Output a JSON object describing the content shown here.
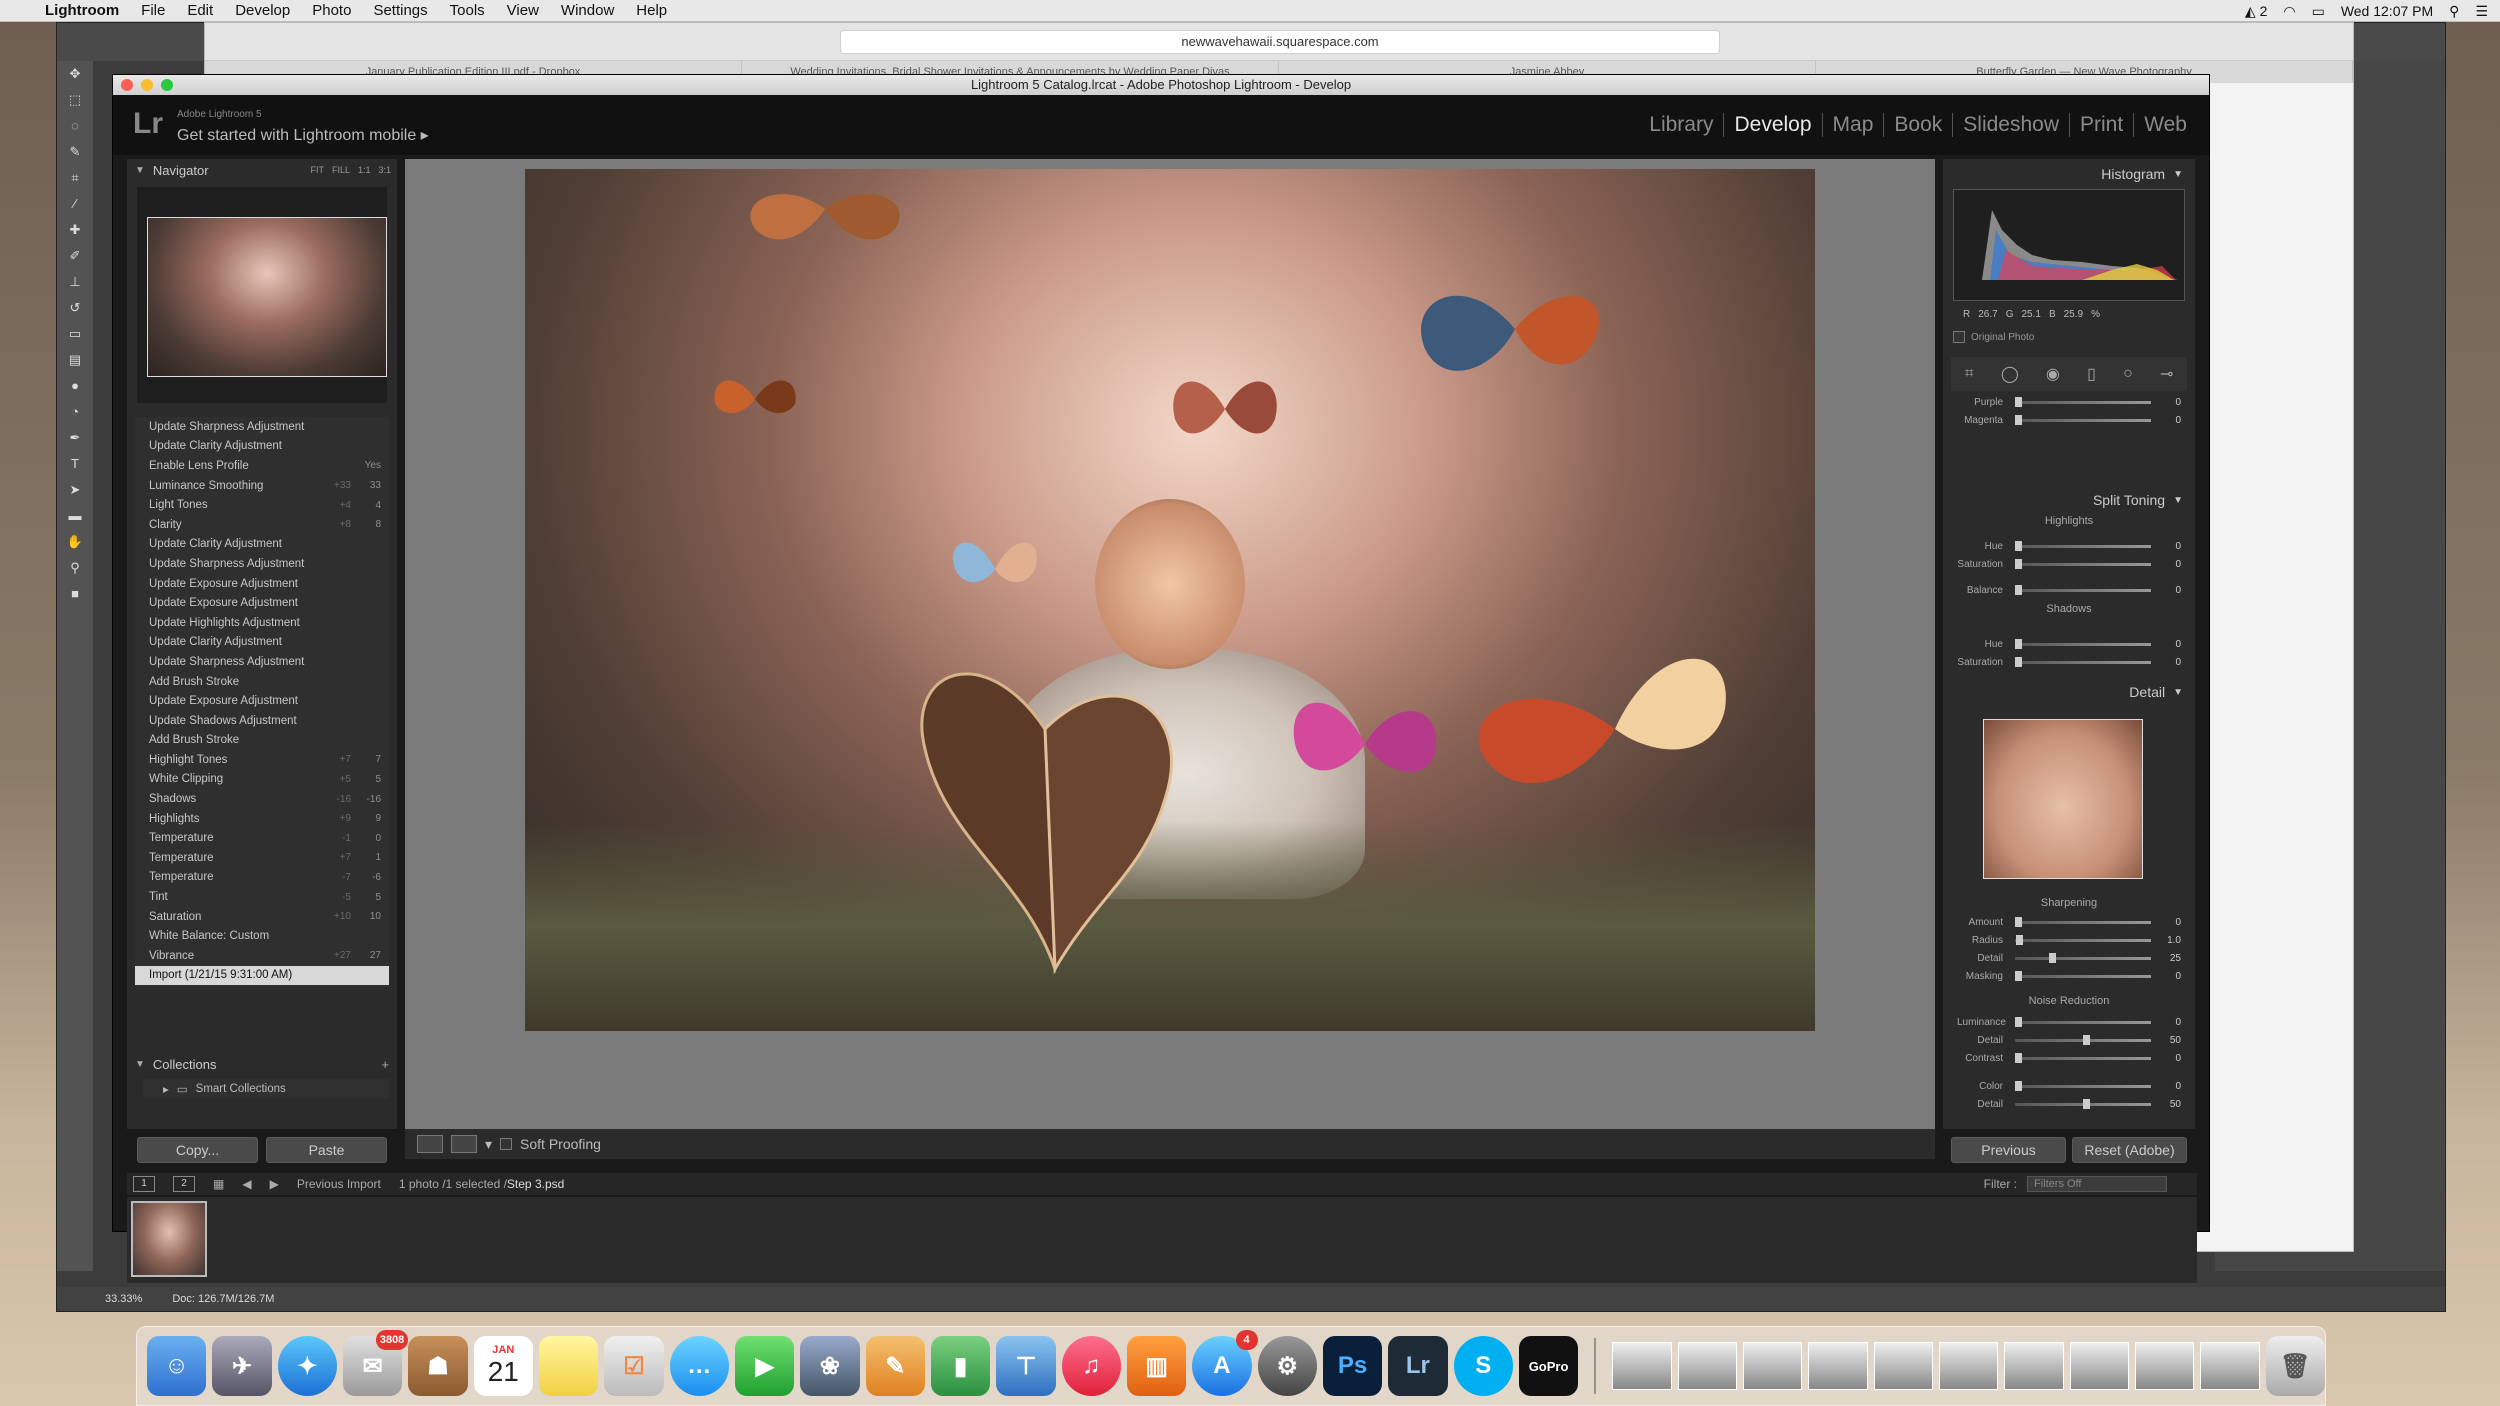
{
  "menubar": {
    "app": "Lightroom",
    "items": [
      "File",
      "Edit",
      "Develop",
      "Photo",
      "Settings",
      "Tools",
      "View",
      "Window",
      "Help"
    ],
    "status_count": "2",
    "clock": "Wed 12:07 PM"
  },
  "browser": {
    "url": "newwavehawaii.squarespace.com",
    "tabs": [
      "January Publication Edition III.pdf - Dropbox",
      "Wedding Invitations, Bridal Shower Invitations & Announcements by Wedding Paper Divas",
      "Jasmine Abbey",
      "Butterfly Garden — New Wave Photography"
    ]
  },
  "photoshop": {
    "zoom": "33.33%",
    "doc": "Doc: 126.7M/126.7M"
  },
  "lightroom": {
    "window_title": "Lightroom 5 Catalog.lrcat - Adobe Photoshop Lightroom - Develop",
    "product": "Adobe Lightroom 5",
    "mobile": "Get started with Lightroom mobile",
    "modules": [
      "Library",
      "Develop",
      "Map",
      "Book",
      "Slideshow",
      "Print",
      "Web"
    ],
    "navigator": {
      "title": "Navigator",
      "options": [
        "FIT",
        "FILL",
        "1:1",
        "3:1"
      ]
    },
    "history": [
      {
        "name": "Update Sharpness Adjustment",
        "delta": "",
        "val": ""
      },
      {
        "name": "Update Clarity Adjustment",
        "delta": "",
        "val": ""
      },
      {
        "name": "Enable Lens Profile",
        "delta": "",
        "val": "Yes"
      },
      {
        "name": "Luminance Smoothing",
        "delta": "+33",
        "val": "33"
      },
      {
        "name": "Light Tones",
        "delta": "+4",
        "val": "4"
      },
      {
        "name": "Clarity",
        "delta": "+8",
        "val": "8"
      },
      {
        "name": "Update Clarity Adjustment",
        "delta": "",
        "val": ""
      },
      {
        "name": "Update Sharpness Adjustment",
        "delta": "",
        "val": ""
      },
      {
        "name": "Update Exposure Adjustment",
        "delta": "",
        "val": ""
      },
      {
        "name": "Update Exposure Adjustment",
        "delta": "",
        "val": ""
      },
      {
        "name": "Update Highlights Adjustment",
        "delta": "",
        "val": ""
      },
      {
        "name": "Update Clarity Adjustment",
        "delta": "",
        "val": ""
      },
      {
        "name": "Update Sharpness Adjustment",
        "delta": "",
        "val": ""
      },
      {
        "name": "Add Brush Stroke",
        "delta": "",
        "val": ""
      },
      {
        "name": "Update Exposure Adjustment",
        "delta": "",
        "val": ""
      },
      {
        "name": "Update Shadows Adjustment",
        "delta": "",
        "val": ""
      },
      {
        "name": "Add Brush Stroke",
        "delta": "",
        "val": ""
      },
      {
        "name": "Highlight Tones",
        "delta": "+7",
        "val": "7"
      },
      {
        "name": "White Clipping",
        "delta": "+5",
        "val": "5"
      },
      {
        "name": "Shadows",
        "delta": "-16",
        "val": "-16"
      },
      {
        "name": "Highlights",
        "delta": "+9",
        "val": "9"
      },
      {
        "name": "Temperature",
        "delta": "-1",
        "val": "0"
      },
      {
        "name": "Temperature",
        "delta": "+7",
        "val": "1"
      },
      {
        "name": "Temperature",
        "delta": "-7",
        "val": "-6"
      },
      {
        "name": "Tint",
        "delta": "-5",
        "val": "5"
      },
      {
        "name": "Saturation",
        "delta": "+10",
        "val": "10"
      },
      {
        "name": "White Balance: Custom",
        "delta": "",
        "val": ""
      },
      {
        "name": "Vibrance",
        "delta": "+27",
        "val": "27"
      },
      {
        "name": "Import (1/21/15 9:31:00 AM)",
        "delta": "",
        "val": "",
        "selected": true
      }
    ],
    "collections": {
      "title": "Collections",
      "smart": "Smart Collections"
    },
    "left_buttons": {
      "copy": "Copy...",
      "paste": "Paste"
    },
    "soft_proofing": "Soft Proofing",
    "histogram": {
      "title": "Histogram",
      "r_label": "R",
      "r": "26.7",
      "g_label": "G",
      "g": "25.1",
      "b_label": "B",
      "b": "25.9",
      "unit": "%",
      "original_photo": "Original Photo"
    },
    "hsl_rows": [
      {
        "label": "Purple",
        "value": "0",
        "pos": 0.5
      },
      {
        "label": "Magenta",
        "value": "0",
        "pos": 0.5
      }
    ],
    "split_toning": {
      "title": "Split Toning",
      "highlights": "Highlights",
      "shadows": "Shadows",
      "hue_label": "Hue",
      "sat_label": "Saturation",
      "balance_label": "Balance",
      "h_hue": "0",
      "h_sat": "0",
      "balance": "0",
      "s_hue": "0",
      "s_sat": "0"
    },
    "detail": {
      "title": "Detail",
      "sharpening": "Sharpening",
      "amount_label": "Amount",
      "amount": "0",
      "radius_label": "Radius",
      "radius": "1.0",
      "detail_label": "Detail",
      "detail": "25",
      "masking_label": "Masking",
      "masking": "0",
      "noise": "Noise Reduction",
      "luminance_label": "Luminance",
      "luminance": "0",
      "ldetail_label": "Detail",
      "ldetail": "50",
      "contrast_label": "Contrast",
      "contrast": "0",
      "color_label": "Color",
      "color": "0",
      "cdetail_label": "Detail",
      "cdetail": "50"
    },
    "right_buttons": {
      "previous": "Previous",
      "reset": "Reset (Adobe)"
    },
    "filmstrip": {
      "view1": "1",
      "view2": "2",
      "source": "Previous Import",
      "count": "1 photo /1 selected /",
      "file": "Step 3.psd",
      "filter_label": "Filter :",
      "filter_value": "Filters Off"
    }
  },
  "dock": {
    "mail_badge": "3808",
    "calendar_month": "JAN",
    "calendar_day": "21",
    "appstore_badge": "4",
    "ps_label": "Ps",
    "lr_label": "Lr",
    "skype_label": "S",
    "gopro_label": "GoPro"
  }
}
